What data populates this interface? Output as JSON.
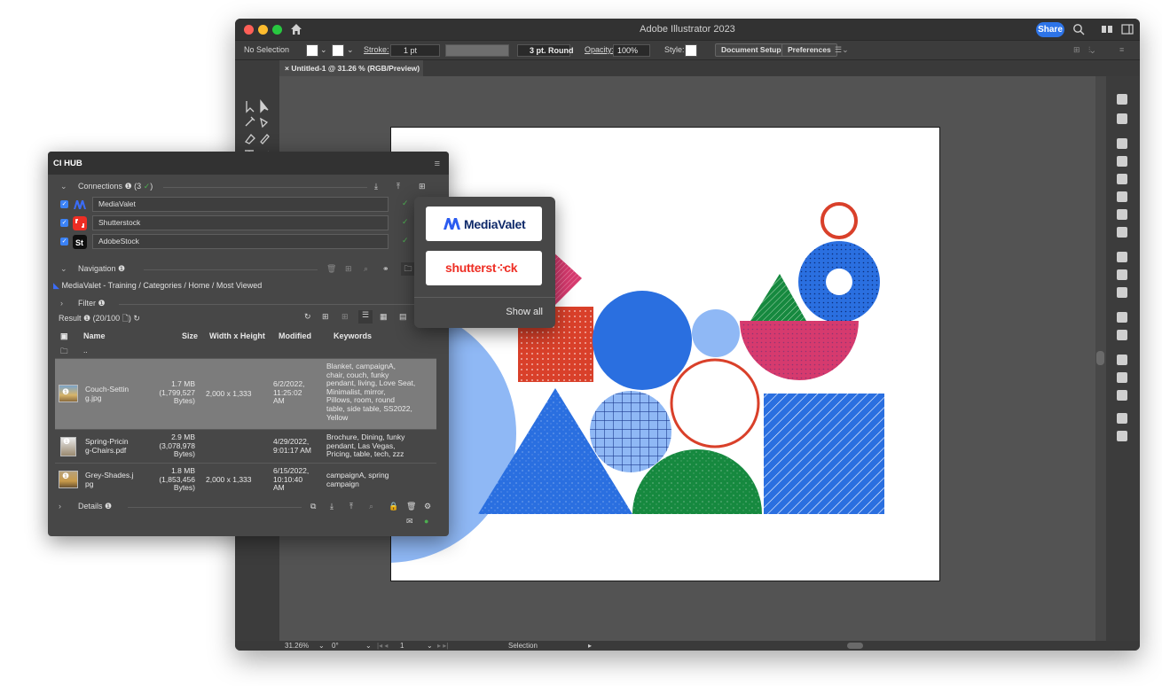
{
  "window": {
    "title": "Adobe Illustrator 2023",
    "share_label": "Share"
  },
  "control_bar": {
    "selection": "No Selection",
    "stroke_label": "Stroke:",
    "stroke_value": "1 pt",
    "brush_label": "3 pt. Round",
    "opacity_label": "Opacity:",
    "opacity_value": "100%",
    "style_label": "Style:",
    "document_setup": "Document Setup",
    "preferences": "Preferences"
  },
  "document_tab": {
    "label": "Untitled-1 @ 31.26 % (RGB/Preview)"
  },
  "status_bar": {
    "zoom": "31.26%",
    "rotation": "0°",
    "artboard": "1",
    "tool": "Selection"
  },
  "cihub": {
    "title": "CI HUB",
    "connections": {
      "label": "Connections",
      "count": "(3",
      "items": [
        {
          "name": "MediaValet"
        },
        {
          "name": "Shutterstock"
        },
        {
          "name": "AdobeStock"
        }
      ]
    },
    "navigation": {
      "label": "Navigation",
      "breadcrumb": "MediaValet - Training / Categories / Home / Most Viewed"
    },
    "filter": {
      "label": "Filter"
    },
    "result": {
      "label": "Result",
      "count": "(20/100"
    },
    "table": {
      "columns": [
        "Name",
        "Size",
        "Width x Height",
        "Modified",
        "Keywords"
      ],
      "parent_folder": "..",
      "rows": [
        {
          "name": "Couch-Setting.jpg",
          "name_lines": [
            "Couch-Settin",
            "g.jpg"
          ],
          "size": "1.7 MB",
          "bytes_lines": [
            "(1,799,527",
            "Bytes)"
          ],
          "dimensions": "2,000 x 1,333",
          "modified_lines": [
            "6/2/2022,",
            "11:25:02",
            "AM"
          ],
          "keyword_lines": [
            "Blanket, campaignA,",
            "chair, couch, funky",
            "pendant, living, Love Seat,",
            "Minimalist, mirror,",
            "Pillows, room, round",
            "table, side table, SS2022,",
            "Yellow"
          ]
        },
        {
          "name": "Spring-Pricing-Chairs.pdf",
          "name_lines": [
            "Spring-Pricin",
            "g-Chairs.pdf"
          ],
          "size": "2.9 MB",
          "bytes_lines": [
            "(3,078,978",
            "Bytes)"
          ],
          "dimensions": "",
          "modified_lines": [
            "4/29/2022,",
            "9:01:17 AM"
          ],
          "keyword_lines": [
            "Brochure, Dining, funky",
            "pendant, Las Vegas,",
            "Pricing, table, tech, zzz"
          ]
        },
        {
          "name": "Grey-Shades.jpg",
          "name_lines": [
            "Grey-Shades.j",
            "pg"
          ],
          "size": "1.8 MB",
          "bytes_lines": [
            "(1,853,456",
            "Bytes)"
          ],
          "dimensions": "2,000 x 1,333",
          "modified_lines": [
            "6/15/2022,",
            "10:10:40",
            "AM"
          ],
          "keyword_lines": [
            "campaignA, spring",
            "campaign"
          ]
        }
      ]
    },
    "details": {
      "label": "Details"
    }
  },
  "popup": {
    "brand1": "MediaValet",
    "brand2_part1": "shutterst",
    "brand2_part2": "ck",
    "show_all": "Show all"
  },
  "colors": {
    "accent_blue": "#2d74e8",
    "check_green": "#4caf50",
    "shutterstock_red": "#ee2e24",
    "art_blue": "#2a6fe0",
    "art_light_blue": "#8fb8f5",
    "art_pink": "#d63a6e",
    "art_green": "#16893f",
    "art_red": "#d9402a"
  }
}
